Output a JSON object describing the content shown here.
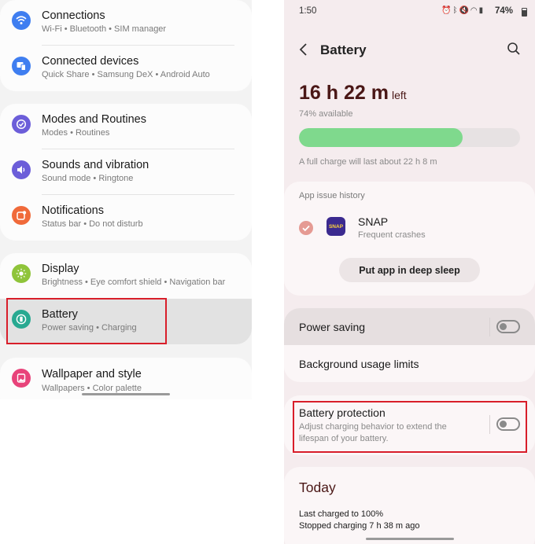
{
  "left_panel": {
    "items": [
      {
        "title": "Connections",
        "subtitle": "Wi-Fi  •  Bluetooth  •  SIM manager",
        "icon": "wifi-icon",
        "color": "#3f7ef0"
      },
      {
        "title": "Connected devices",
        "subtitle": "Quick Share  •  Samsung DeX  •  Android Auto",
        "icon": "connected-devices-icon",
        "color": "#3f7ef0"
      },
      {
        "title": "Modes and Routines",
        "subtitle": "Modes  •  Routines",
        "icon": "check-circle-icon",
        "color": "#6c5ed9"
      },
      {
        "title": "Sounds and vibration",
        "subtitle": "Sound mode  •  Ringtone",
        "icon": "speaker-icon",
        "color": "#6c5ed9"
      },
      {
        "title": "Notifications",
        "subtitle": "Status bar  •  Do not disturb",
        "icon": "notification-icon",
        "color": "#f06a3a"
      },
      {
        "title": "Display",
        "subtitle": "Brightness  •  Eye comfort shield  •  Navigation bar",
        "icon": "sun-icon",
        "color": "#8fc43a"
      },
      {
        "title": "Battery",
        "subtitle": "Power saving  •  Charging",
        "icon": "battery-icon",
        "color": "#28a991"
      },
      {
        "title": "Wallpaper and style",
        "subtitle": "Wallpapers  •  Color palette",
        "icon": "wallpaper-icon",
        "color": "#e8437a"
      }
    ]
  },
  "right_panel": {
    "status_bar": {
      "time": "1:50",
      "battery": "74%"
    },
    "header": {
      "title": "Battery"
    },
    "summary": {
      "time_left": "16 h 22 m",
      "left_word": "left",
      "available": "74% available",
      "charge_fraction": 0.74,
      "full_charge": "A full charge will last about 22 h 8 m"
    },
    "app_issue": {
      "heading": "App issue history",
      "app_name": "SNAP",
      "app_icon_text": "SNAP",
      "app_status": "Frequent crashes",
      "button_label": "Put app in deep sleep"
    },
    "power_saving_label": "Power saving",
    "background_limits_label": "Background usage limits",
    "battery_protection": {
      "title": "Battery protection",
      "desc_line1": "Adjust charging behavior to extend the",
      "desc_line2": "lifespan of your battery."
    },
    "today": {
      "heading": "Today",
      "line1": "Last charged to 100%",
      "line2": "Stopped charging 7 h 38 m ago"
    }
  },
  "colors": {
    "highlight_box": "#d81e2a",
    "battery_bar": "#7fd98d",
    "dark_red_text": "#4a1716"
  }
}
